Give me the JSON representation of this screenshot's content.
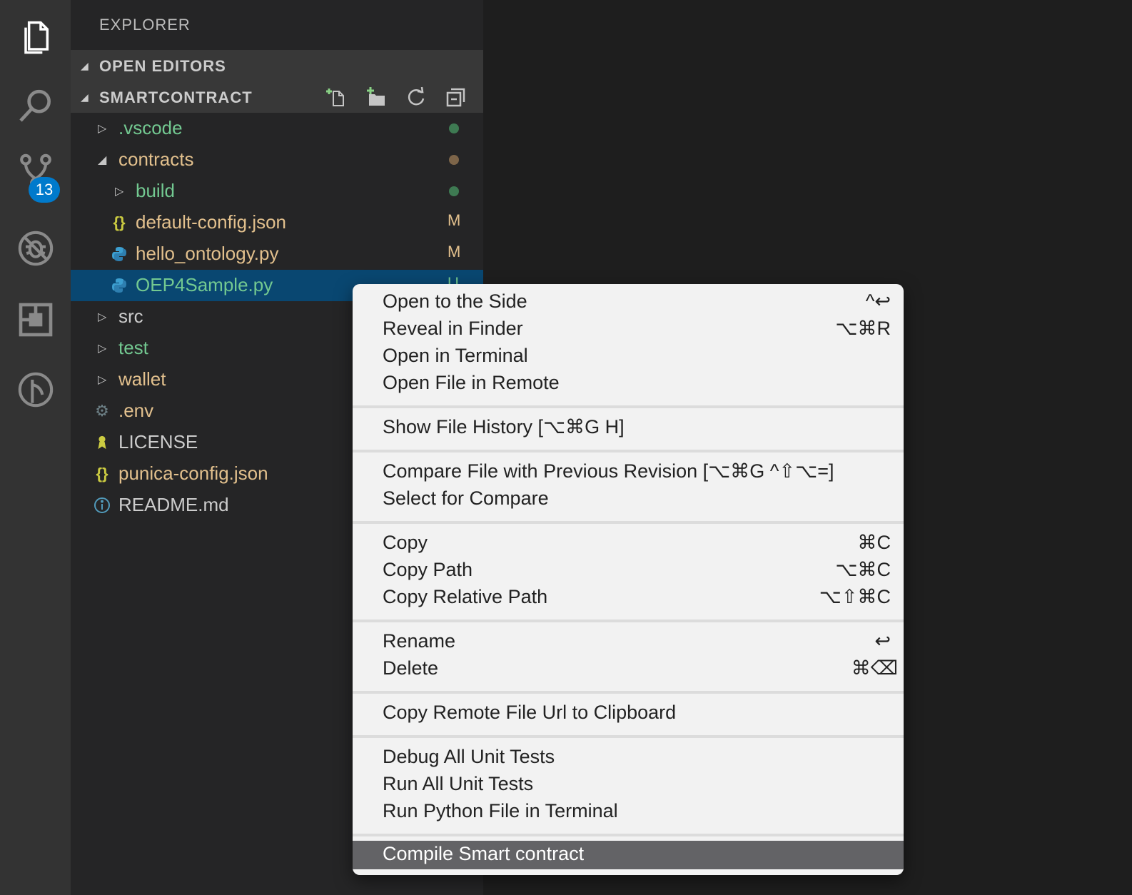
{
  "activity_bar": {
    "icons": [
      "explorer-icon",
      "search-icon",
      "source-control-icon",
      "debug-icon",
      "extensions-icon",
      "deploy-icon"
    ],
    "scm_badge": "13"
  },
  "sidebar": {
    "title": "EXPLORER",
    "open_editors_label": "OPEN EDITORS",
    "project_label": "SMARTCONTRACT",
    "project_actions": [
      "new-file-icon",
      "new-folder-icon",
      "refresh-icon",
      "collapse-all-icon"
    ],
    "tree": [
      {
        "name": ".vscode",
        "status": "dot-green"
      },
      {
        "name": "contracts",
        "status": "dot-amber"
      },
      {
        "name": "build",
        "status": "dot-green"
      },
      {
        "name": "default-config.json",
        "status": "M"
      },
      {
        "name": "hello_ontology.py",
        "status": "M"
      },
      {
        "name": "OEP4Sample.py",
        "status": "U"
      },
      {
        "name": "src"
      },
      {
        "name": "test"
      },
      {
        "name": "wallet"
      },
      {
        "name": ".env"
      },
      {
        "name": "LICENSE"
      },
      {
        "name": "punica-config.json"
      },
      {
        "name": "README.md"
      }
    ],
    "colors": {
      "modified": "#e2c08d",
      "untracked": "#73c991",
      "selected": "#094771"
    }
  },
  "context_menu": {
    "groups": [
      [
        {
          "label": "Open to the Side",
          "shortcut": "^↩"
        },
        {
          "label": "Reveal in Finder",
          "shortcut": "⌥⌘R"
        },
        {
          "label": "Open in Terminal",
          "shortcut": ""
        },
        {
          "label": "Open File in Remote",
          "shortcut": ""
        }
      ],
      [
        {
          "label": "Show File History [⌥⌘G H]",
          "shortcut": ""
        }
      ],
      [
        {
          "label": "Compare File with Previous Revision [⌥⌘G ^⇧⌥=]",
          "shortcut": ""
        },
        {
          "label": "Select for Compare",
          "shortcut": ""
        }
      ],
      [
        {
          "label": "Copy",
          "shortcut": "⌘C"
        },
        {
          "label": "Copy Path",
          "shortcut": "⌥⌘C"
        },
        {
          "label": "Copy Relative Path",
          "shortcut": "⌥⇧⌘C"
        }
      ],
      [
        {
          "label": "Rename",
          "shortcut": "↩"
        },
        {
          "label": "Delete",
          "shortcut": "⌘⌫"
        }
      ],
      [
        {
          "label": "Copy Remote File Url to Clipboard",
          "shortcut": ""
        }
      ],
      [
        {
          "label": "Debug All Unit Tests",
          "shortcut": ""
        },
        {
          "label": "Run All Unit Tests",
          "shortcut": ""
        },
        {
          "label": "Run Python File in Terminal",
          "shortcut": ""
        }
      ],
      [
        {
          "label": "Compile Smart contract",
          "shortcut": ""
        }
      ]
    ]
  }
}
